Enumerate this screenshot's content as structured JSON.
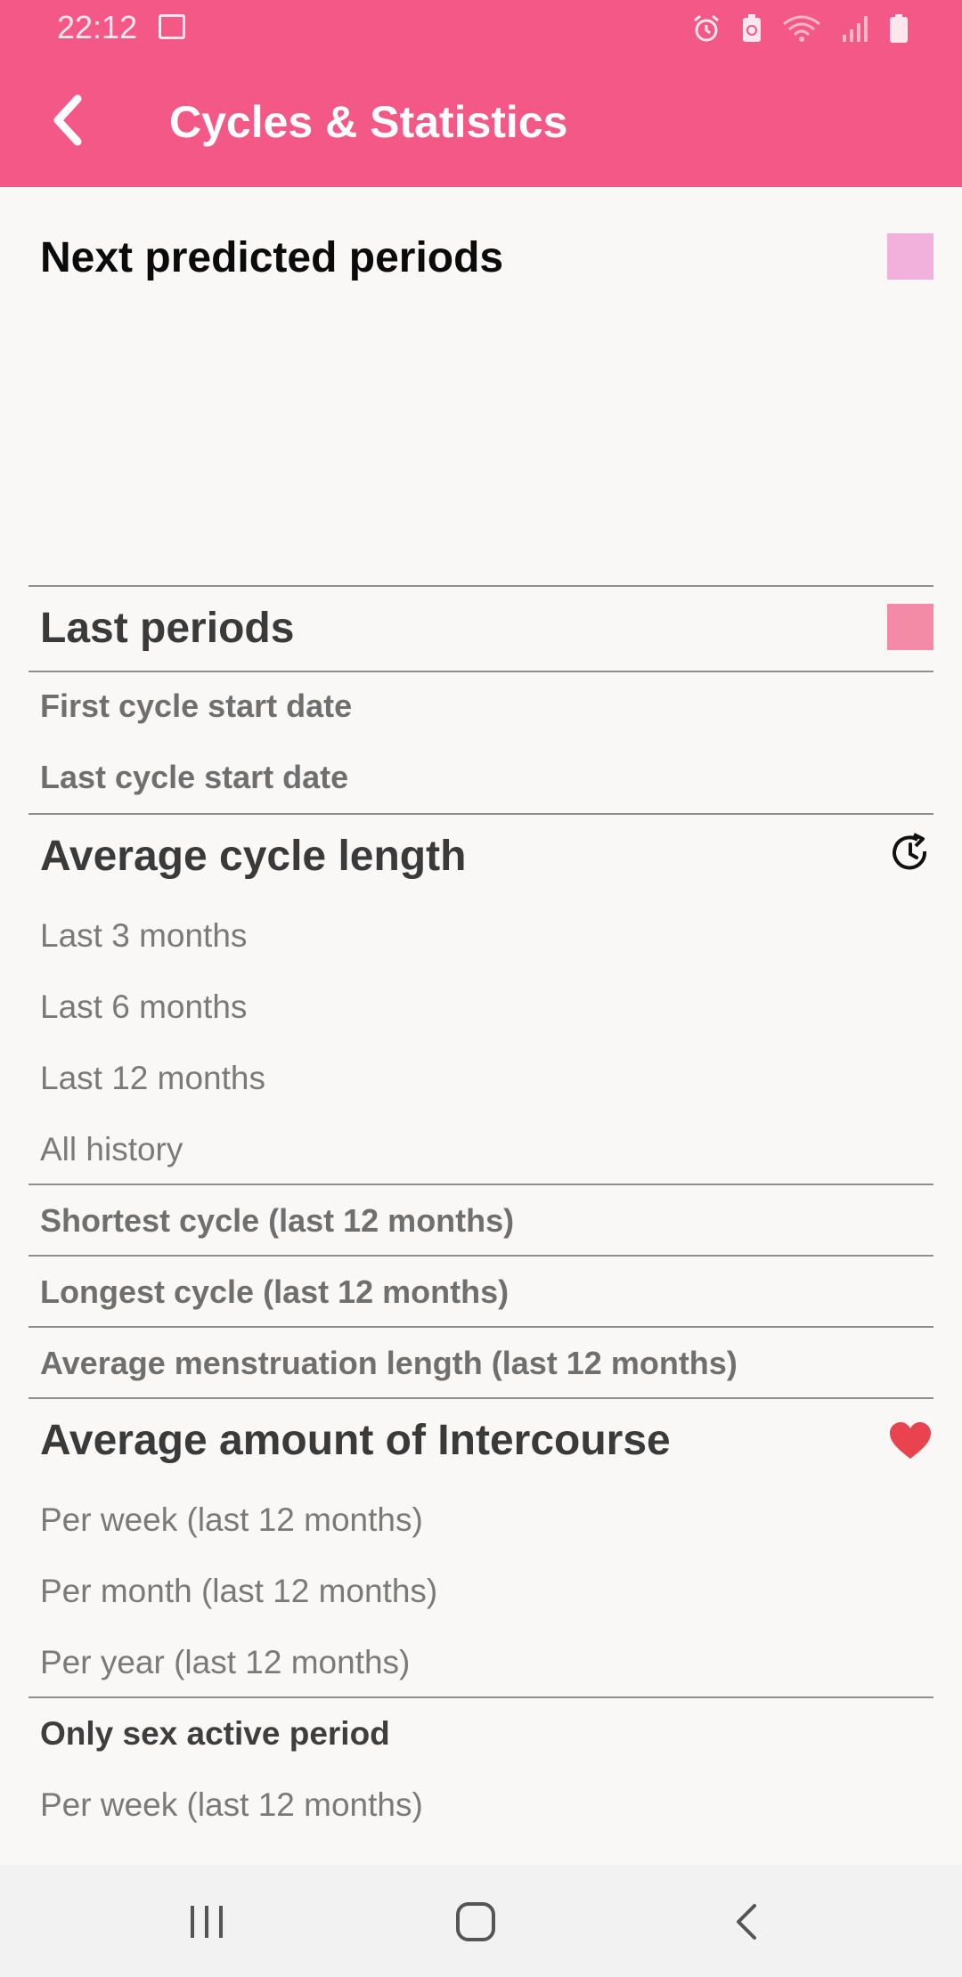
{
  "status_bar": {
    "time": "22:12",
    "icons": [
      "gallery-icon",
      "alarm-icon",
      "battery-saver-icon",
      "wifi-icon",
      "signal-icon",
      "battery-icon"
    ]
  },
  "app_bar": {
    "title": "Cycles & Statistics",
    "back_icon": "chevron-left-icon",
    "color": "#f45886"
  },
  "sections": {
    "next_predicted": {
      "title": "Next predicted periods",
      "swatch_color": "#f2b1dc"
    },
    "last_periods": {
      "title": "Last periods",
      "swatch_color": "#f48ba6",
      "first_cycle": "First cycle start date",
      "last_cycle": "Last cycle start date"
    },
    "average_cycle": {
      "title": "Average cycle length",
      "icon": "history-refresh-icon",
      "items": [
        "Last 3 months",
        "Last 6 months",
        "Last 12 months",
        "All history"
      ]
    },
    "shortest_cycle": "Shortest cycle (last 12 months)",
    "longest_cycle": "Longest cycle (last 12 months)",
    "average_menstruation": "Average menstruation length (last 12 months)",
    "intercourse": {
      "title": "Average amount of Intercourse",
      "icon": "heart-icon",
      "heart_color": "#e8434f",
      "items": [
        "Per week (last 12 months)",
        "Per month (last 12 months)",
        "Per year (last 12 months)"
      ]
    },
    "sex_active": {
      "title": "Only sex active period",
      "items": [
        "Per week (last 12 months)"
      ]
    }
  },
  "nav_bar": {
    "buttons": [
      "recent-apps-icon",
      "home-icon",
      "back-icon"
    ]
  }
}
